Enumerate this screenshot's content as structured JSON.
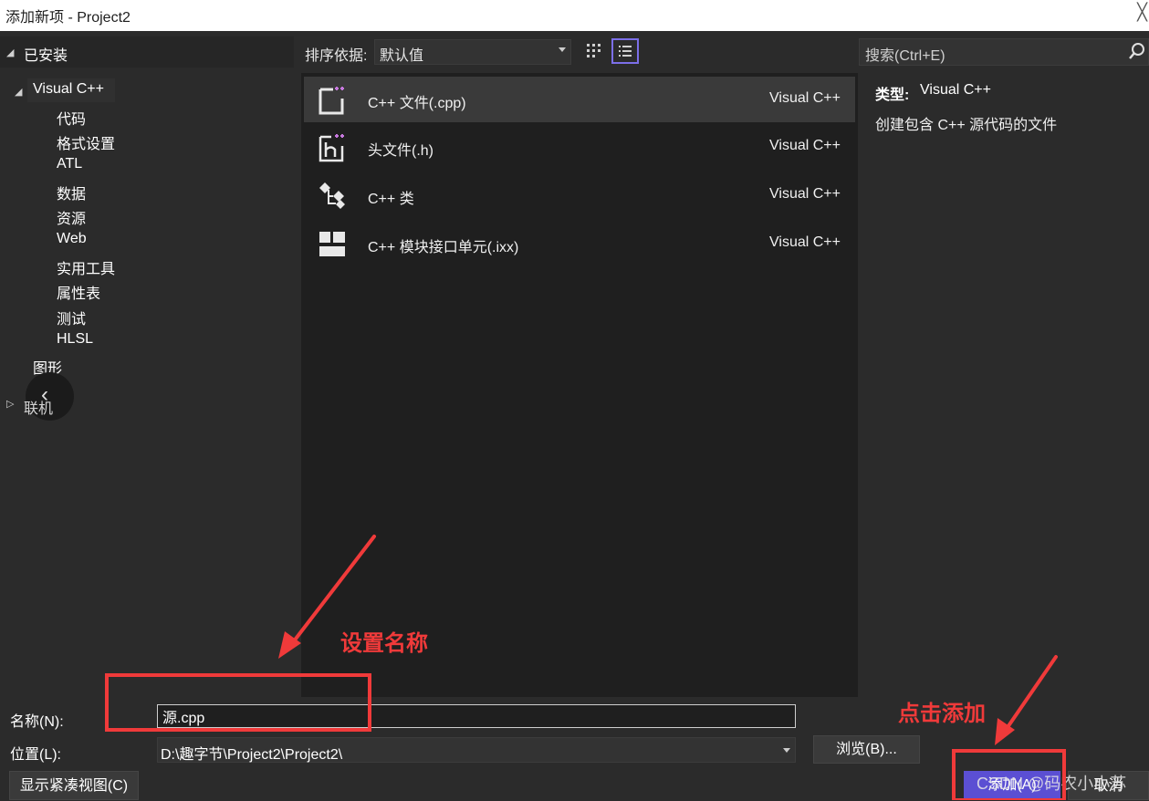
{
  "window": {
    "title": "添加新项 - Project2",
    "close_glyph": "╳"
  },
  "tree": {
    "header": "已安装",
    "root": "Visual C++",
    "children": [
      "代码",
      "格式设置",
      "ATL",
      "数据",
      "资源",
      "Web",
      "实用工具",
      "属性表",
      "测试",
      "HLSL"
    ],
    "graphics": "图形",
    "online": "联机"
  },
  "sortbar": {
    "label": "排序依据:",
    "value": "默认值"
  },
  "templates": [
    {
      "name": "C++ 文件(.cpp)",
      "lang": "Visual C++",
      "icon": "cpp-file-icon",
      "selected": true
    },
    {
      "name": "头文件(.h)",
      "lang": "Visual C++",
      "icon": "header-file-icon",
      "selected": false
    },
    {
      "name": "C++ 类",
      "lang": "Visual C++",
      "icon": "class-icon",
      "selected": false
    },
    {
      "name": "C++ 模块接口单元(.ixx)",
      "lang": "Visual C++",
      "icon": "module-icon",
      "selected": false
    }
  ],
  "search": {
    "placeholder": "搜索(Ctrl+E)"
  },
  "details": {
    "type_label": "类型:",
    "type_value": "Visual C++",
    "description": "创建包含 C++ 源代码的文件"
  },
  "form": {
    "name_label": "名称(N):",
    "name_value": "源.cpp",
    "location_label": "位置(L):",
    "location_value": "D:\\趣字节\\Project2\\Project2\\",
    "browse": "浏览(B)...",
    "compact_view": "显示紧凑视图(C)",
    "add": "添加(A)",
    "cancel": "取消"
  },
  "annotations": {
    "set_name": "设置名称",
    "click_add": "点击添加"
  },
  "watermark": "CSDN @码农小小苏",
  "colors": {
    "accent": "#5b4fd3",
    "annotation": "#f03a3a",
    "icon_plus": "#c678dd"
  }
}
